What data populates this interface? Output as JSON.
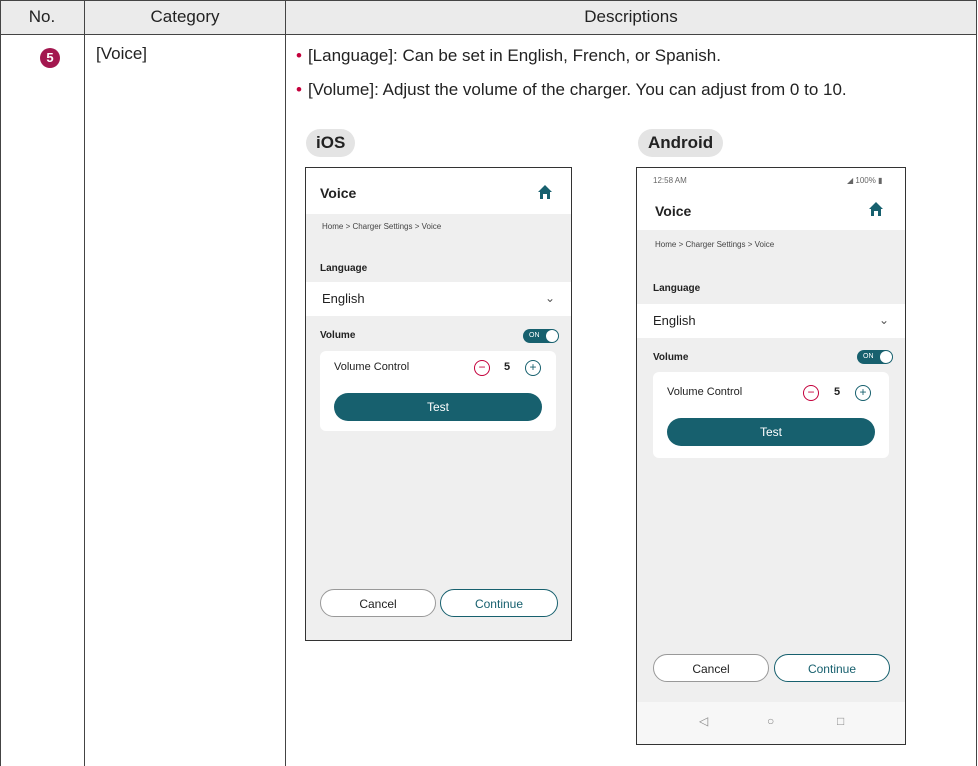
{
  "table": {
    "headers": [
      "No.",
      "Category",
      "Descriptions"
    ],
    "row_number": "5",
    "category": "[Voice]",
    "bullets": [
      "[Language]: Can be set in English, French, or Spanish.",
      "[Volume]: Adjust the volume of the charger. You can adjust from 0 to 10."
    ]
  },
  "ios": {
    "platform_label": "iOS",
    "title": "Voice",
    "breadcrumb": "Home  >  Charger Settings  >  Voice",
    "language_label": "Language",
    "language_value": "English",
    "volume_label": "Volume",
    "toggle_text": "ON",
    "volume_control_label": "Volume Control",
    "volume_value": "5",
    "test_label": "Test",
    "cancel_label": "Cancel",
    "continue_label": "Continue"
  },
  "android": {
    "platform_label": "Android",
    "time": "12:58 AM",
    "battery": "100%",
    "title": "Voice",
    "breadcrumb": "Home  >  Charger Settings  >  Voice",
    "language_label": "Language",
    "language_value": "English",
    "volume_label": "Volume",
    "toggle_text": "ON",
    "volume_control_label": "Volume Control",
    "volume_value": "5",
    "test_label": "Test",
    "cancel_label": "Cancel",
    "continue_label": "Continue"
  },
  "colors": {
    "accent": "#17606e",
    "badge": "#a3174f",
    "minus": "#c4003c"
  },
  "icons": [
    "home-icon",
    "chevron-down-icon",
    "minus-icon",
    "plus-icon",
    "back-icon",
    "home-circle-icon",
    "recents-icon",
    "signal-icon",
    "battery-icon"
  ]
}
